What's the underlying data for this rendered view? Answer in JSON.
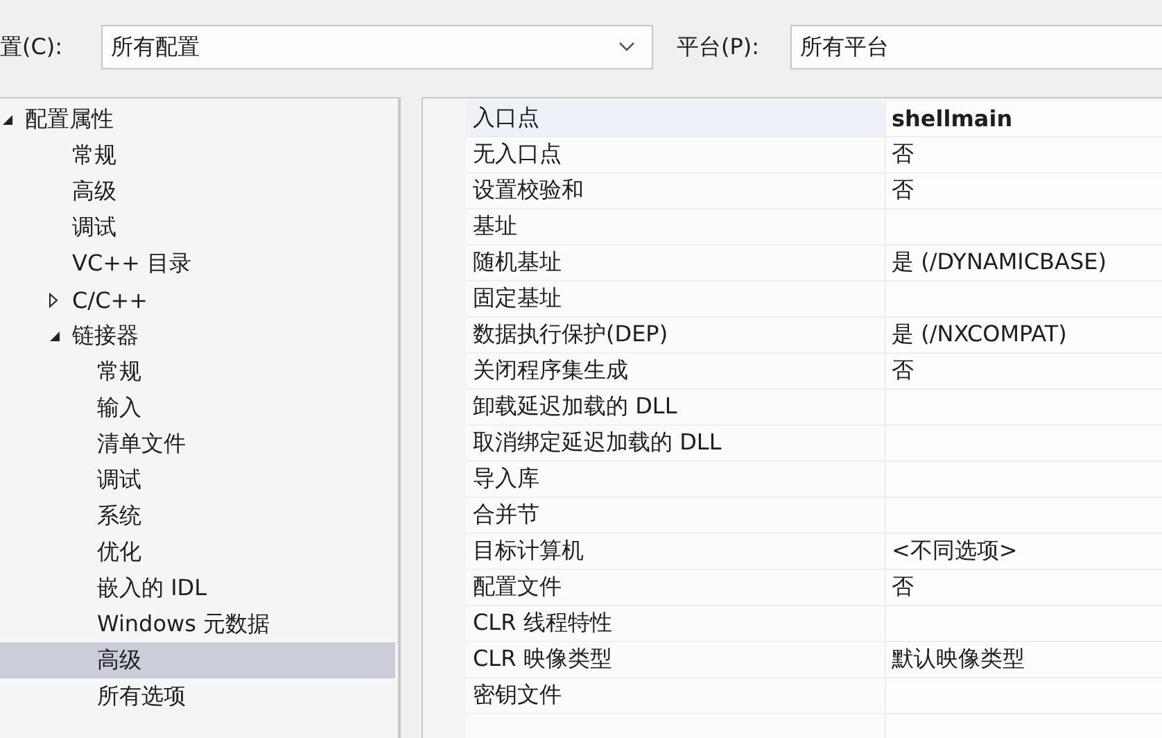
{
  "toolbar": {
    "config_label": "置(C):",
    "config_value": "所有配置",
    "platform_label": "平台(P):",
    "platform_value": "所有平台"
  },
  "tree": [
    {
      "label": "配置属性",
      "expanded": true,
      "selected": false,
      "children": [
        {
          "label": "常规",
          "selected": false
        },
        {
          "label": "高级",
          "selected": false
        },
        {
          "label": "调试",
          "selected": false
        },
        {
          "label": "VC++ 目录",
          "selected": false
        },
        {
          "label": "C/C++",
          "expanded": false,
          "selected": false
        },
        {
          "label": "链接器",
          "expanded": true,
          "selected": false,
          "children": [
            {
              "label": "常规",
              "selected": false
            },
            {
              "label": "输入",
              "selected": false
            },
            {
              "label": "清单文件",
              "selected": false
            },
            {
              "label": "调试",
              "selected": false
            },
            {
              "label": "系统",
              "selected": false
            },
            {
              "label": "优化",
              "selected": false
            },
            {
              "label": "嵌入的 IDL",
              "selected": false
            },
            {
              "label": "Windows 元数据",
              "selected": false
            },
            {
              "label": "高级",
              "selected": true
            },
            {
              "label": "所有选项",
              "selected": false
            }
          ]
        }
      ]
    }
  ],
  "properties": [
    {
      "name": "入口点",
      "value": "shellmain",
      "bold": true,
      "selected": true
    },
    {
      "name": "无入口点",
      "value": "否",
      "bold": false,
      "selected": false
    },
    {
      "name": "设置校验和",
      "value": "否",
      "bold": false,
      "selected": false
    },
    {
      "name": "基址",
      "selected": false
    },
    {
      "name": "随机基址",
      "value": "是 (/DYNAMICBASE)",
      "bold": false,
      "selected": false
    },
    {
      "name": "固定基址",
      "selected": false
    },
    {
      "name": "数据执行保护(DEP)",
      "value": "是 (/NXCOMPAT)",
      "bold": false,
      "selected": false
    },
    {
      "name": "关闭程序集生成",
      "value": "否",
      "bold": false,
      "selected": false
    },
    {
      "name": "卸载延迟加载的 DLL",
      "selected": false
    },
    {
      "name": "取消绑定延迟加载的 DLL",
      "selected": false
    },
    {
      "name": "导入库",
      "selected": false
    },
    {
      "name": "合并节",
      "selected": false
    },
    {
      "name": "目标计算机",
      "value": "<不同选项>",
      "bold": false,
      "selected": false
    },
    {
      "name": "配置文件",
      "value": "否",
      "bold": false,
      "selected": false
    },
    {
      "name": "CLR 线程特性",
      "selected": false
    },
    {
      "name": "CLR 映像类型",
      "value": "默认映像类型",
      "bold": false,
      "selected": false
    },
    {
      "name": "密钥文件",
      "selected": false
    }
  ]
}
